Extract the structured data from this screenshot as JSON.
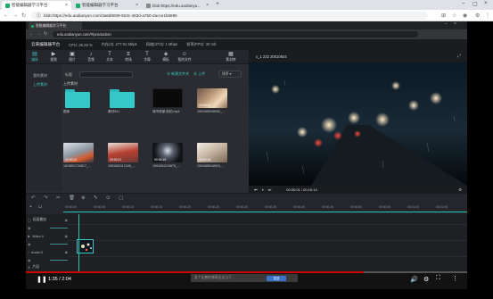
{
  "outer_browser": {
    "tabs": [
      {
        "title": "智能编辑器学习平台",
        "active": true
      },
      {
        "title": "智能编辑器学习平台",
        "active": false
      },
      {
        "title": "blob:https://edu.aodianyu...",
        "active": false
      }
    ],
    "new_tab": "+",
    "url": "blob:https://edu.aodianyun.com/3a6d8008-923c-483d-a750-2acce1b6895"
  },
  "inner_browser": {
    "tab_title": "智能编辑器学习平台",
    "url": "edu.aodianyun.com/#/production",
    "app_bar": {
      "brand": "云来编辑器平台",
      "cpu": "CPU: 26.28 %",
      "mem": "内存(3): 277.81 Mbps",
      "speed": "网络(37/3): 1 Mbps",
      "frame": "帧率(FPS): 30 mb"
    }
  },
  "toolbar": {
    "items": [
      {
        "icon": "folder-icon",
        "glyph": "▤",
        "label": "媒体",
        "selected": true
      },
      {
        "icon": "video-icon",
        "glyph": "▶",
        "label": "视频"
      },
      {
        "icon": "image-icon",
        "glyph": "▣",
        "label": "图片"
      },
      {
        "icon": "music-icon",
        "glyph": "♪",
        "label": "音频"
      },
      {
        "icon": "text-icon",
        "glyph": "T",
        "label": "文本"
      },
      {
        "icon": "transition-icon",
        "glyph": "⧖",
        "label": "转场"
      },
      {
        "icon": "subtitle-icon",
        "glyph": "T",
        "label": "字幕"
      },
      {
        "icon": "template-icon",
        "glyph": "◈",
        "label": "模板"
      },
      {
        "icon": "mine-icon",
        "glyph": "☺",
        "label": "我的文件"
      },
      {
        "icon": "material-icon",
        "glyph": "▦",
        "label": "素材库"
      }
    ]
  },
  "library": {
    "side_items": [
      {
        "label": "我的素材",
        "selected": false
      },
      {
        "label": "上传素材",
        "selected": true
      }
    ],
    "search_label": "标题",
    "search_placeholder": "",
    "new_folder": "⊕ 新建文件夹",
    "upload": "⊕ 上传",
    "sort": "排序 ▾",
    "section_title": "上传素材",
    "items": [
      {
        "kind": "folder",
        "label": "图库",
        "duration": ""
      },
      {
        "kind": "folder",
        "label": "素材001",
        "duration": ""
      },
      {
        "kind": "video",
        "label": "城市夜景 航拍.mp4",
        "duration": ""
      },
      {
        "kind": "image",
        "label": "1591685048092_...",
        "duration": "00:00:10"
      },
      {
        "kind": "video",
        "label": "1619801734817_...",
        "duration": "00:00:10"
      },
      {
        "kind": "video",
        "label": "1591654112346_...",
        "duration": "00:00:21"
      },
      {
        "kind": "video",
        "label": "1591654219876_...",
        "duration": "00:00:15"
      },
      {
        "kind": "video",
        "label": "1591685048924_...",
        "duration": "00:00:16"
      }
    ]
  },
  "preview": {
    "title": "x_1 232 20010924",
    "expand": "⤢",
    "time": "00:00:01 / 00:16:14",
    "settings": "⚙"
  },
  "timeline": {
    "tools": [
      "↶",
      "↷",
      "✂",
      "🗑",
      "⊕",
      "✎",
      "⊙",
      "▢"
    ],
    "ticks": [
      "00:00:00",
      "00:00:05",
      "00:00:10",
      "00:00:15",
      "00:00:20",
      "00:00:25",
      "00:00:30",
      "00:00:35",
      "00:00:40",
      "00:00:45",
      "00:00:50",
      "00:00:55",
      "00:01:00",
      "00:01:05"
    ],
    "tracks": [
      {
        "label": "画面叠加",
        "icon": "▢"
      },
      {
        "label": "",
        "icon": "◉"
      },
      {
        "label": "Video 0",
        "icon": "▶"
      },
      {
        "label": "",
        "icon": "◉"
      },
      {
        "label": "Audio 0",
        "icon": "♪"
      },
      {
        "label": "",
        "icon": "◉"
      },
      {
        "label": "片段",
        "icon": "⊕"
      }
    ]
  },
  "player": {
    "time": "1:35 / 2:04",
    "progress": 0.766,
    "caption_placeholder": "发个友善的弹幕见证当下",
    "caption_send": "发送",
    "controls": [
      "volume-icon",
      "settings-icon",
      "fullscreen-icon",
      "more-icon"
    ]
  }
}
